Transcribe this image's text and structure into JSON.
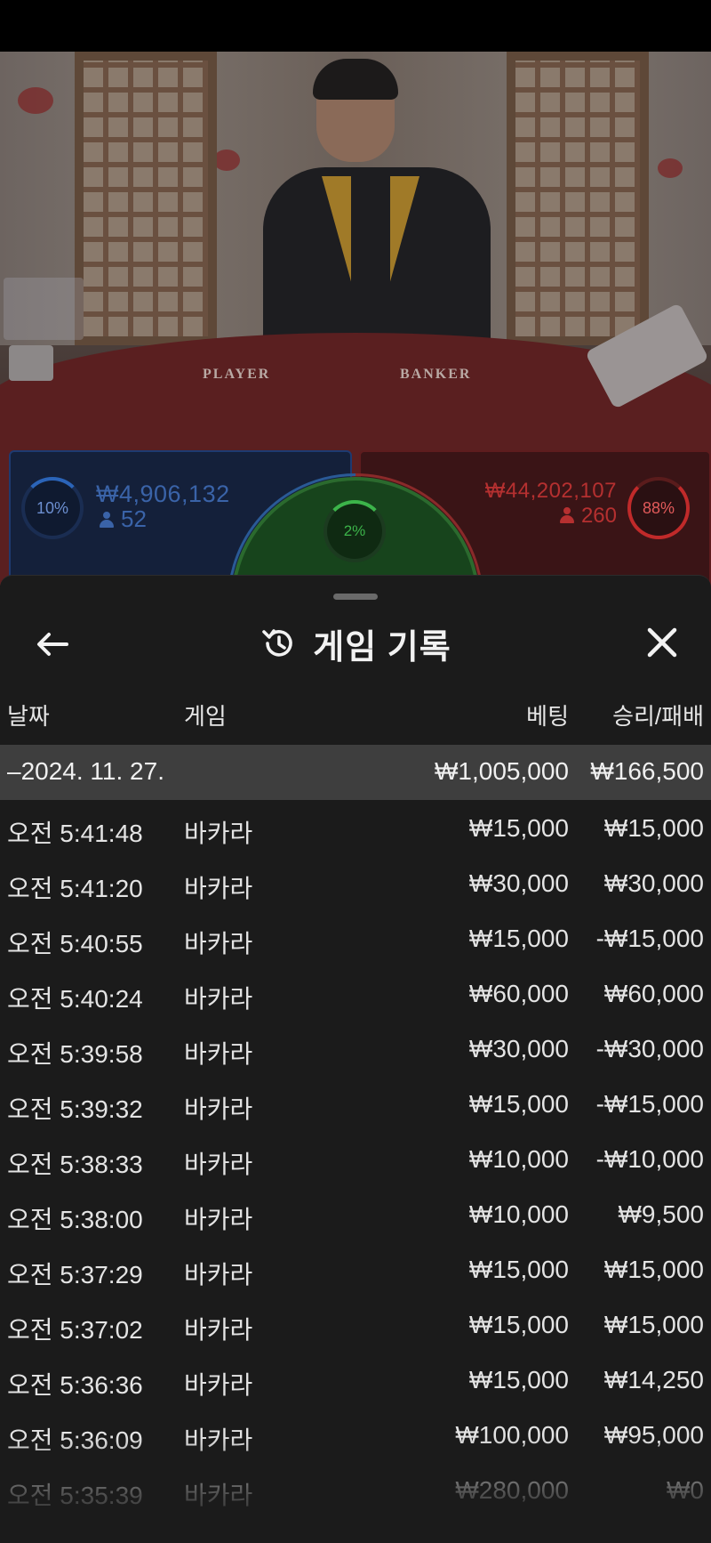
{
  "video": {
    "felt_player_label": "PLAYER",
    "felt_banker_label": "BANKER"
  },
  "bets": {
    "player": {
      "percent": "10%",
      "amount": "₩4,906,132",
      "count": "52",
      "color": "#2b64b8"
    },
    "tie": {
      "percent": "2%",
      "color": "#3cb44a"
    },
    "banker": {
      "percent": "88%",
      "amount": "₩44,202,107",
      "count": "260",
      "color": "#c02a2a"
    }
  },
  "sheet": {
    "title": "게임 기록",
    "title_icon": "history-icon",
    "back_icon": "arrow-left-icon",
    "close_icon": "close-icon",
    "columns": {
      "date": "날짜",
      "game": "게임",
      "bet": "베팅",
      "win_loss": "승리/패배"
    },
    "summary": {
      "date": "–2024. 11. 27.",
      "bet": "₩1,005,000",
      "win_loss": "₩166,500"
    },
    "rows": [
      {
        "time": "오전 5:41:48",
        "game": "바카라",
        "bet": "₩15,000",
        "win_loss": "₩15,000"
      },
      {
        "time": "오전 5:41:20",
        "game": "바카라",
        "bet": "₩30,000",
        "win_loss": "₩30,000"
      },
      {
        "time": "오전 5:40:55",
        "game": "바카라",
        "bet": "₩15,000",
        "win_loss": "-₩15,000"
      },
      {
        "time": "오전 5:40:24",
        "game": "바카라",
        "bet": "₩60,000",
        "win_loss": "₩60,000"
      },
      {
        "time": "오전 5:39:58",
        "game": "바카라",
        "bet": "₩30,000",
        "win_loss": "-₩30,000"
      },
      {
        "time": "오전 5:39:32",
        "game": "바카라",
        "bet": "₩15,000",
        "win_loss": "-₩15,000"
      },
      {
        "time": "오전 5:38:33",
        "game": "바카라",
        "bet": "₩10,000",
        "win_loss": "-₩10,000"
      },
      {
        "time": "오전 5:38:00",
        "game": "바카라",
        "bet": "₩10,000",
        "win_loss": "₩9,500"
      },
      {
        "time": "오전 5:37:29",
        "game": "바카라",
        "bet": "₩15,000",
        "win_loss": "₩15,000"
      },
      {
        "time": "오전 5:37:02",
        "game": "바카라",
        "bet": "₩15,000",
        "win_loss": "₩15,000"
      },
      {
        "time": "오전 5:36:36",
        "game": "바카라",
        "bet": "₩15,000",
        "win_loss": "₩14,250"
      },
      {
        "time": "오전 5:36:09",
        "game": "바카라",
        "bet": "₩100,000",
        "win_loss": "₩95,000"
      },
      {
        "time": "오전 5:35:39",
        "game": "바카라",
        "bet": "₩280,000",
        "win_loss": "₩0"
      }
    ]
  }
}
